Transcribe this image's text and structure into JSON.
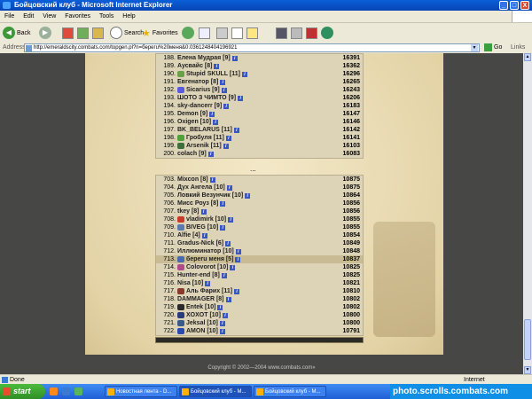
{
  "window": {
    "title": "Бойцовский клуб - Microsoft Internet Explorer",
    "buttons": [
      "_",
      "□",
      "X"
    ]
  },
  "menu": [
    "File",
    "Edit",
    "View",
    "Favorites",
    "Tools",
    "Help"
  ],
  "toolbar": {
    "back": "Back",
    "search": "Search",
    "favorites": "Favorites"
  },
  "address": {
    "label": "Address",
    "url": "http://emeraldscity.combats.com/topgen.pl?n=берегu%20меня&0.0361248404196921",
    "go": "Go",
    "links": "Links"
  },
  "ranking": {
    "top": [
      {
        "rank": "188.",
        "name": "Елена Мудрая [9]",
        "score": "16391",
        "icon": ""
      },
      {
        "rank": "189.",
        "name": "Аусвайс [8]",
        "score": "16362",
        "icon": ""
      },
      {
        "rank": "190.",
        "name": "Stupid SKULL [11]",
        "score": "16296",
        "icon": "#6aa04a"
      },
      {
        "rank": "191.",
        "name": "Евгенатор [8]",
        "score": "16265",
        "icon": ""
      },
      {
        "rank": "192.",
        "name": "Sicarius [9]",
        "score": "16243",
        "icon": "#5a5adf"
      },
      {
        "rank": "193.",
        "name": "ШОТО З ЧИМТО [9]",
        "score": "16206",
        "icon": ""
      },
      {
        "rank": "194.",
        "name": "sky-dancerr [9]",
        "score": "16183",
        "icon": ""
      },
      {
        "rank": "195.",
        "name": "Demon [9]",
        "score": "16147",
        "icon": ""
      },
      {
        "rank": "196.",
        "name": "Oxigen [10]",
        "score": "16146",
        "icon": ""
      },
      {
        "rank": "197.",
        "name": "BK_BELARUS [11]",
        "score": "16142",
        "icon": ""
      },
      {
        "rank": "198.",
        "name": "Гробуля [11]",
        "score": "16141",
        "icon": "#4fa23a"
      },
      {
        "rank": "199.",
        "name": "Arsenik [11]",
        "score": "16103",
        "icon": "#3f6f3a"
      },
      {
        "rank": "200.",
        "name": "colach [9]",
        "score": "16083",
        "icon": ""
      }
    ],
    "separator": "...",
    "bottom": [
      {
        "rank": "703.",
        "name": "Mixcon [8]",
        "score": "10875",
        "icon": ""
      },
      {
        "rank": "704.",
        "name": "Дух Ангела [10]",
        "score": "10875",
        "icon": ""
      },
      {
        "rank": "705.",
        "name": "Ловкий Везунчик [10]",
        "score": "10864",
        "icon": ""
      },
      {
        "rank": "706.",
        "name": "Мисс Роуз [8]",
        "score": "10856",
        "icon": ""
      },
      {
        "rank": "707.",
        "name": "tkey [8]",
        "score": "10856",
        "icon": ""
      },
      {
        "rank": "708.",
        "name": "vladimirk [10]",
        "score": "10855",
        "icon": "#c83a2a"
      },
      {
        "rank": "709.",
        "name": "BIVEG [10]",
        "score": "10855",
        "icon": "#5a7ab0"
      },
      {
        "rank": "710.",
        "name": "Alfie [4]",
        "score": "10854",
        "icon": ""
      },
      {
        "rank": "711.",
        "name": "Gradus-Nick [6]",
        "score": "10849",
        "icon": ""
      },
      {
        "rank": "712.",
        "name": "Иллюминатор [10]",
        "score": "10848",
        "icon": ""
      },
      {
        "rank": "713.",
        "name": "берегu меня [5]",
        "score": "10837",
        "icon": "#4a6ab0",
        "highlight": true
      },
      {
        "rank": "714.",
        "name": "Colovorot [10]",
        "score": "10825",
        "icon": "#b04a8a"
      },
      {
        "rank": "715.",
        "name": "Hunter-end [8]",
        "score": "10825",
        "icon": ""
      },
      {
        "rank": "716.",
        "name": "Nisa [10]",
        "score": "10821",
        "icon": ""
      },
      {
        "rank": "717.",
        "name": "Аль Фарих [11]",
        "score": "10810",
        "icon": "#8a3a2a"
      },
      {
        "rank": "718.",
        "name": "DAMMAGER [8]",
        "score": "10802",
        "icon": ""
      },
      {
        "rank": "719.",
        "name": "Entek [10]",
        "score": "10802",
        "icon": "#2a2a2a"
      },
      {
        "rank": "720.",
        "name": "XOXOT [10]",
        "score": "10800",
        "icon": "#2a3a7a"
      },
      {
        "rank": "721.",
        "name": "Jeksal [10]",
        "score": "10800",
        "icon": "#3a5a8a"
      },
      {
        "rank": "722.",
        "name": "AMON [10]",
        "score": "10791",
        "icon": "#2a4ab0"
      }
    ]
  },
  "footer": {
    "copyright": "Copyright © 2002—2004 www.combats.com»"
  },
  "status": {
    "text": "Done",
    "zone": "Internet"
  },
  "taskbar": {
    "start": "start",
    "tasks": [
      "Новостная лента - D...",
      "Бойцовский клуб - M...",
      "Бойцовский клуб - M..."
    ],
    "watermark": "photo.scrolls.combats.com"
  }
}
